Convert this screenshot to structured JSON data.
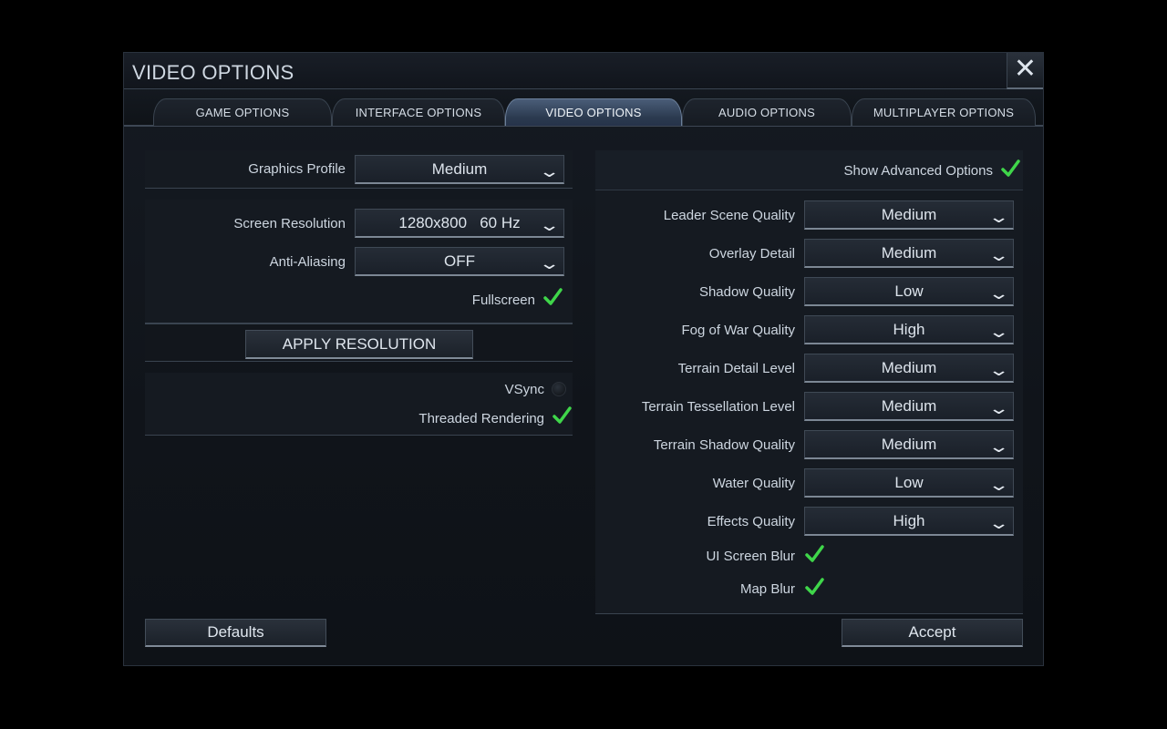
{
  "dialog": {
    "title": "VIDEO OPTIONS",
    "close_icon": "close-icon"
  },
  "tabs": [
    {
      "label": "GAME OPTIONS",
      "active": false
    },
    {
      "label": "INTERFACE OPTIONS",
      "active": false
    },
    {
      "label": "VIDEO OPTIONS",
      "active": true
    },
    {
      "label": "AUDIO OPTIONS",
      "active": false
    },
    {
      "label": "MULTIPLAYER OPTIONS",
      "active": false
    }
  ],
  "left": {
    "graphics_profile": {
      "label": "Graphics Profile",
      "value": "Medium"
    },
    "screen_resolution": {
      "label": "Screen Resolution",
      "value": "1280x800   60 Hz"
    },
    "anti_aliasing": {
      "label": "Anti-Aliasing",
      "value": "OFF"
    },
    "fullscreen": {
      "label": "Fullscreen",
      "checked": true
    },
    "apply_label": "APPLY RESOLUTION",
    "vsync": {
      "label": "VSync",
      "checked": false
    },
    "threaded_rendering": {
      "label": "Threaded Rendering",
      "checked": true
    }
  },
  "right": {
    "show_advanced": {
      "label": "Show Advanced Options",
      "checked": true
    },
    "settings": [
      {
        "label": "Leader Scene Quality",
        "value": "Medium"
      },
      {
        "label": "Overlay Detail",
        "value": "Medium"
      },
      {
        "label": "Shadow Quality",
        "value": "Low"
      },
      {
        "label": "Fog of War Quality",
        "value": "High"
      },
      {
        "label": "Terrain Detail Level",
        "value": "Medium"
      },
      {
        "label": "Terrain Tessellation Level",
        "value": "Medium"
      },
      {
        "label": "Terrain Shadow Quality",
        "value": "Medium"
      },
      {
        "label": "Water Quality",
        "value": "Low"
      },
      {
        "label": "Effects Quality",
        "value": "High"
      }
    ],
    "ui_screen_blur": {
      "label": "UI Screen Blur",
      "checked": true
    },
    "map_blur": {
      "label": "Map Blur",
      "checked": true
    }
  },
  "footer": {
    "defaults_label": "Defaults",
    "accept_label": "Accept"
  },
  "colors": {
    "check_green": "#3fd64a",
    "active_tab": "#3b4c66"
  }
}
